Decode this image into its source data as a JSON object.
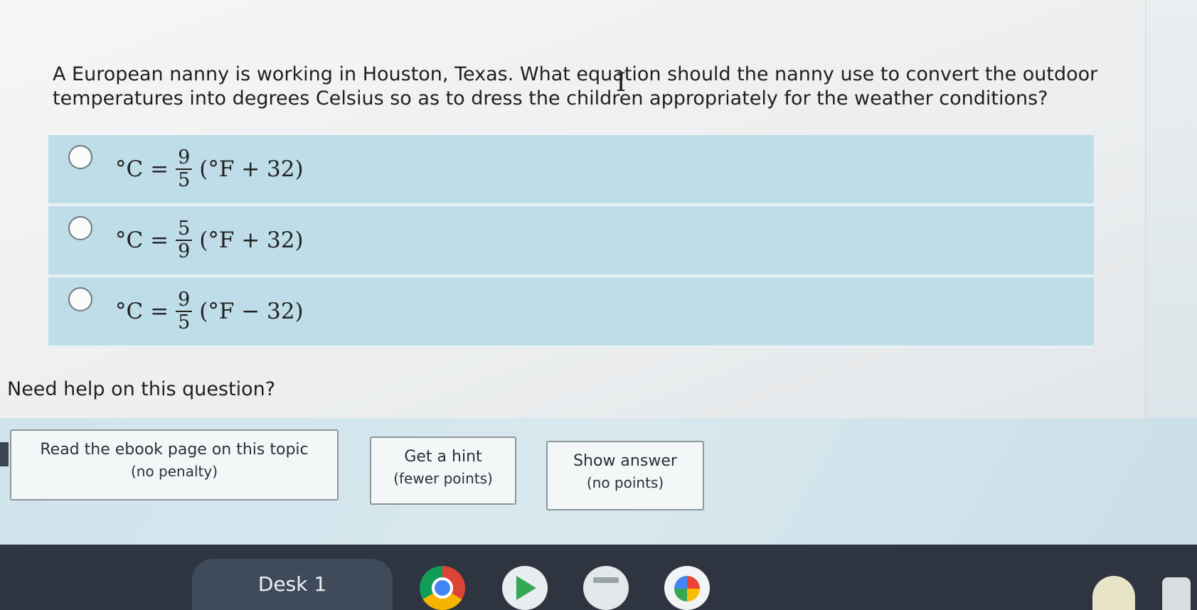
{
  "question": "A European nanny is working in Houston, Texas. What equation should the nanny use to convert the outdoor temperatures into degrees Celsius so as to dress the children appropriately for the weather conditions?",
  "options": [
    {
      "lhs": "°C =",
      "num": "9",
      "den": "5",
      "rhs": "(°F + 32)"
    },
    {
      "lhs": "°C =",
      "num": "5",
      "den": "9",
      "rhs": "(°F + 32)"
    },
    {
      "lhs": "°C =",
      "num": "9",
      "den": "5",
      "rhs": "(°F − 32)"
    }
  ],
  "help": {
    "heading": "Need help on this question?",
    "ebook": {
      "label": "Read the ebook page on this topic",
      "sub": "(no penalty)"
    },
    "hint": {
      "label": "Get a hint",
      "sub": "(fewer points)"
    },
    "answer": {
      "label": "Show answer",
      "sub": "(no points)"
    }
  },
  "taskbar": {
    "desk_label": "Desk 1",
    "apps": [
      "chrome-icon",
      "play-store-icon",
      "files-icon",
      "photos-icon"
    ]
  },
  "colors": {
    "option_bg": "#bfdde8",
    "taskbar_bg": "#2e3440"
  }
}
